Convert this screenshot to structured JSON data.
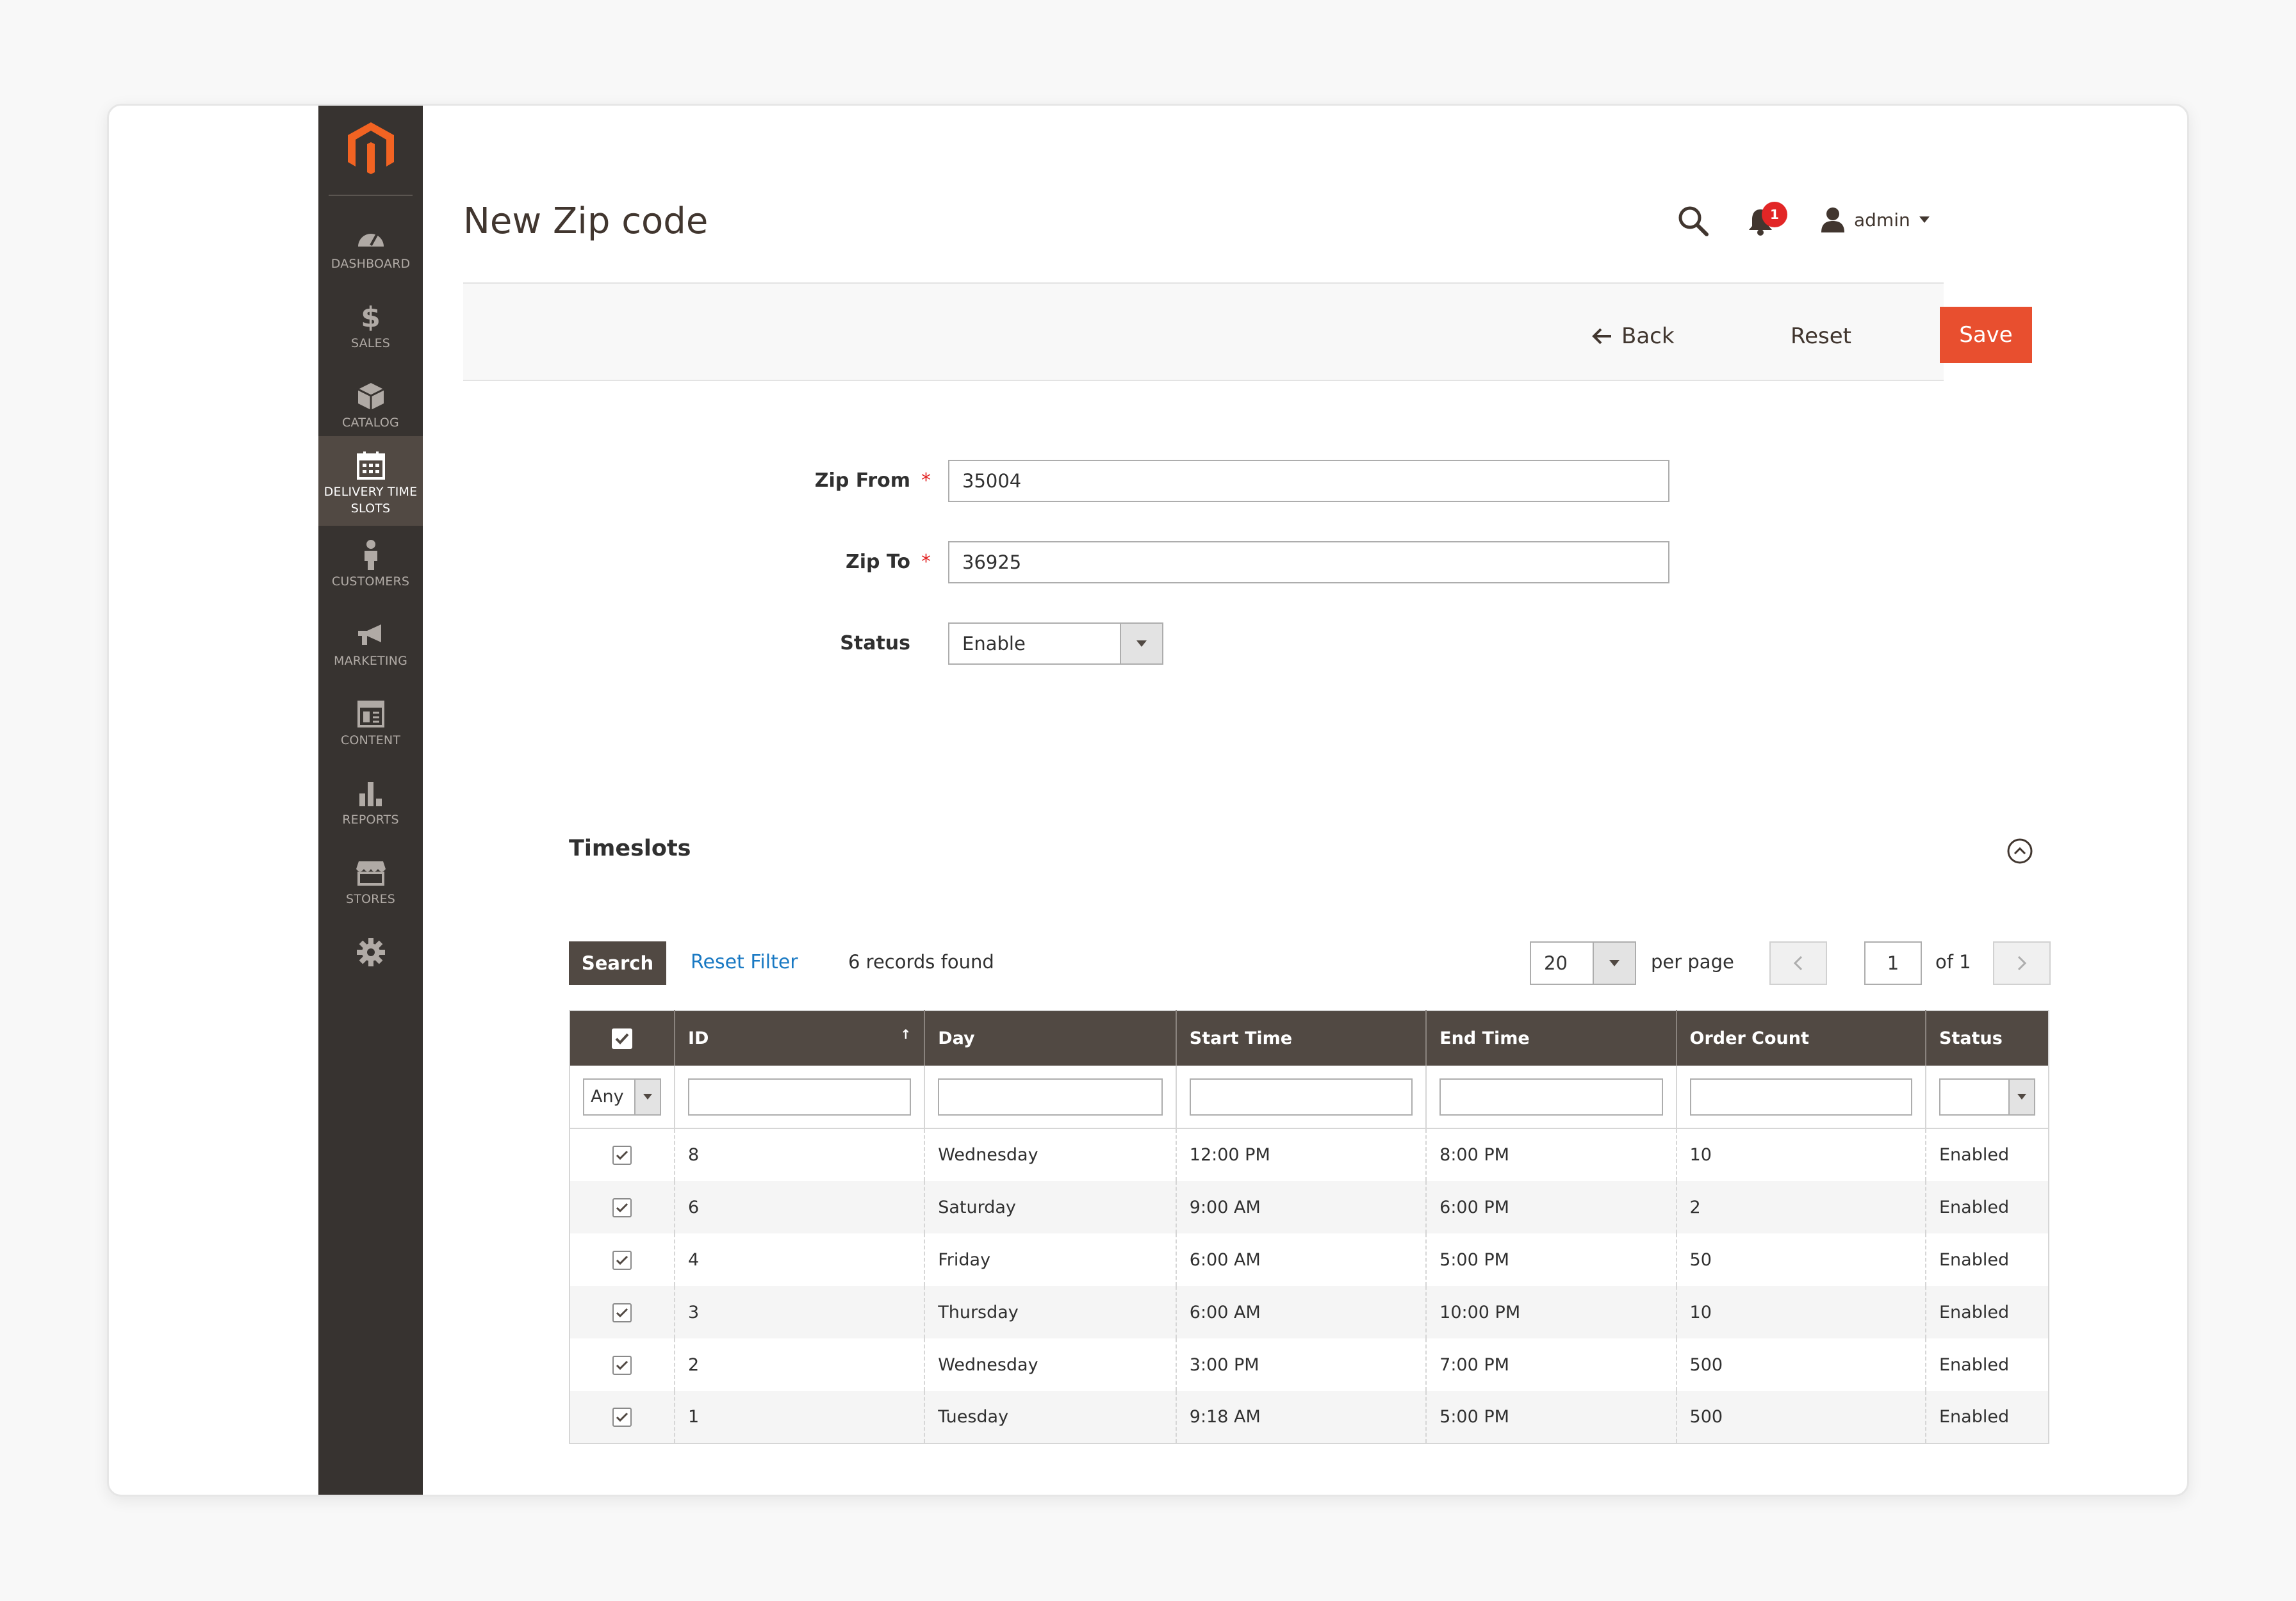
{
  "sidebar": {
    "items": [
      {
        "label": "DASHBOARD",
        "icon": "dashboard-icon"
      },
      {
        "label": "$",
        "icon": "dollar-icon"
      },
      {
        "label": "SALES",
        "icon": "dollar-icon"
      },
      {
        "label": "CATALOG",
        "icon": "cube-icon"
      },
      {
        "label": "DELIVERY TIME",
        "icon": "calendar-icon"
      },
      {
        "label": "SLOTS",
        "icon": "calendar-icon"
      },
      {
        "label": "CUSTOMERS",
        "icon": "person-icon"
      },
      {
        "label": "MARKETING",
        "icon": "megaphone-icon"
      },
      {
        "label": "CONTENT",
        "icon": "layout-icon"
      },
      {
        "label": "REPORTS",
        "icon": "bar-chart-icon"
      },
      {
        "label": "STORES",
        "icon": "store-icon"
      }
    ]
  },
  "header": {
    "title": "New Zip code",
    "notification_count": "1",
    "user": "admin"
  },
  "actions": {
    "back": "Back",
    "reset": "Reset",
    "save": "Save"
  },
  "form": {
    "zip_from_label": "Zip From",
    "zip_from_value": "35004",
    "zip_to_label": "Zip To",
    "zip_to_value": "36925",
    "status_label": "Status",
    "status_value": "Enable",
    "required_mark": "*"
  },
  "timeslots": {
    "title": "Timeslots",
    "search_button": "Search",
    "reset_filter": "Reset Filter",
    "records_found": "6 records found",
    "per_page_value": "20",
    "per_page_label": "per page",
    "page_current": "1",
    "page_of": "of 1",
    "filter_any": "Any",
    "sort_indicator": "↑",
    "columns": [
      "ID",
      "Day",
      "Start Time",
      "End Time",
      "Order Count",
      "Status"
    ],
    "rows": [
      {
        "id": "8",
        "day": "Wednesday",
        "start": "12:00 PM",
        "end": "8:00 PM",
        "count": "10",
        "status": "Enabled"
      },
      {
        "id": "6",
        "day": "Saturday",
        "start": "9:00 AM",
        "end": "6:00 PM",
        "count": "2",
        "status": "Enabled"
      },
      {
        "id": "4",
        "day": "Friday",
        "start": "6:00 AM",
        "end": "5:00 PM",
        "count": "50",
        "status": "Enabled"
      },
      {
        "id": "3",
        "day": "Thursday",
        "start": "6:00 AM",
        "end": "10:00 PM",
        "count": "10",
        "status": "Enabled"
      },
      {
        "id": "2",
        "day": "Wednesday",
        "start": "3:00 PM",
        "end": "7:00 PM",
        "count": "500",
        "status": "Enabled"
      },
      {
        "id": "1",
        "day": "Tuesday",
        "start": "9:18 AM",
        "end": "5:00 PM",
        "count": "500",
        "status": "Enabled"
      }
    ]
  },
  "colors": {
    "sidebar_bg": "#373330",
    "sidebar_active": "#514943",
    "accent": "#e84f2f",
    "logo": "#f26322",
    "link": "#1979c3",
    "grid_header": "#514943"
  }
}
